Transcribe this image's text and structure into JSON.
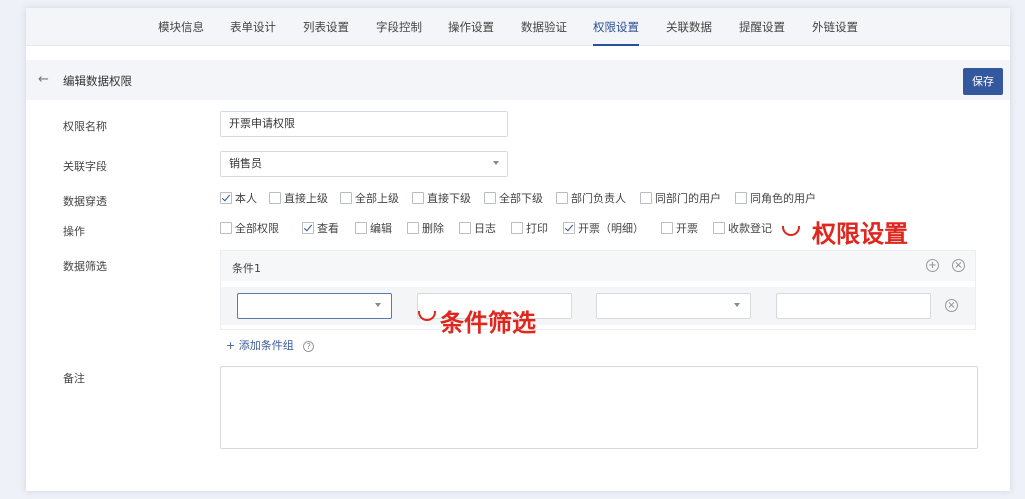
{
  "tabs": [
    "模块信息",
    "表单设计",
    "列表设置",
    "字段控制",
    "操作设置",
    "数据验证",
    "权限设置",
    "关联数据",
    "提醒设置",
    "外链设置"
  ],
  "active_tab_index": 6,
  "header": {
    "back_icon": "←",
    "title": "编辑数据权限",
    "save_label": "保存"
  },
  "form": {
    "name_label": "权限名称",
    "name_value": "开票申请权限",
    "field_label": "关联字段",
    "field_value": "销售员",
    "penetrate_label": "数据穿透",
    "penetrate_options": [
      {
        "label": "本人",
        "checked": true
      },
      {
        "label": "直接上级",
        "checked": false
      },
      {
        "label": "全部上级",
        "checked": false
      },
      {
        "label": "直接下级",
        "checked": false
      },
      {
        "label": "全部下级",
        "checked": false
      },
      {
        "label": "部门负责人",
        "checked": false
      },
      {
        "label": "同部门的用户",
        "checked": false
      },
      {
        "label": "同角色的用户",
        "checked": false
      }
    ],
    "ops_label": "操作",
    "ops_options": [
      {
        "label": "全部权限",
        "checked": false
      },
      {
        "label": "查看",
        "checked": true
      },
      {
        "label": "编辑",
        "checked": false
      },
      {
        "label": "删除",
        "checked": false
      },
      {
        "label": "日志",
        "checked": false
      },
      {
        "label": "打印",
        "checked": false
      },
      {
        "label": "开票（明细）",
        "checked": true
      },
      {
        "label": "开票",
        "checked": false
      },
      {
        "label": "收款登记",
        "checked": false
      }
    ],
    "filter_label": "数据筛选",
    "condition_title": "条件1",
    "add_group_label": "添加条件组",
    "remark_label": "备注"
  },
  "annotations": {
    "permission": "权限设置",
    "filter": "条件筛选"
  },
  "icons": {
    "add": "⊕",
    "remove": "⊗",
    "help": "?",
    "plus": "+"
  },
  "colors": {
    "accent": "#2c4f9a",
    "save_button": "#34589e",
    "annotation": "#e0261d"
  }
}
